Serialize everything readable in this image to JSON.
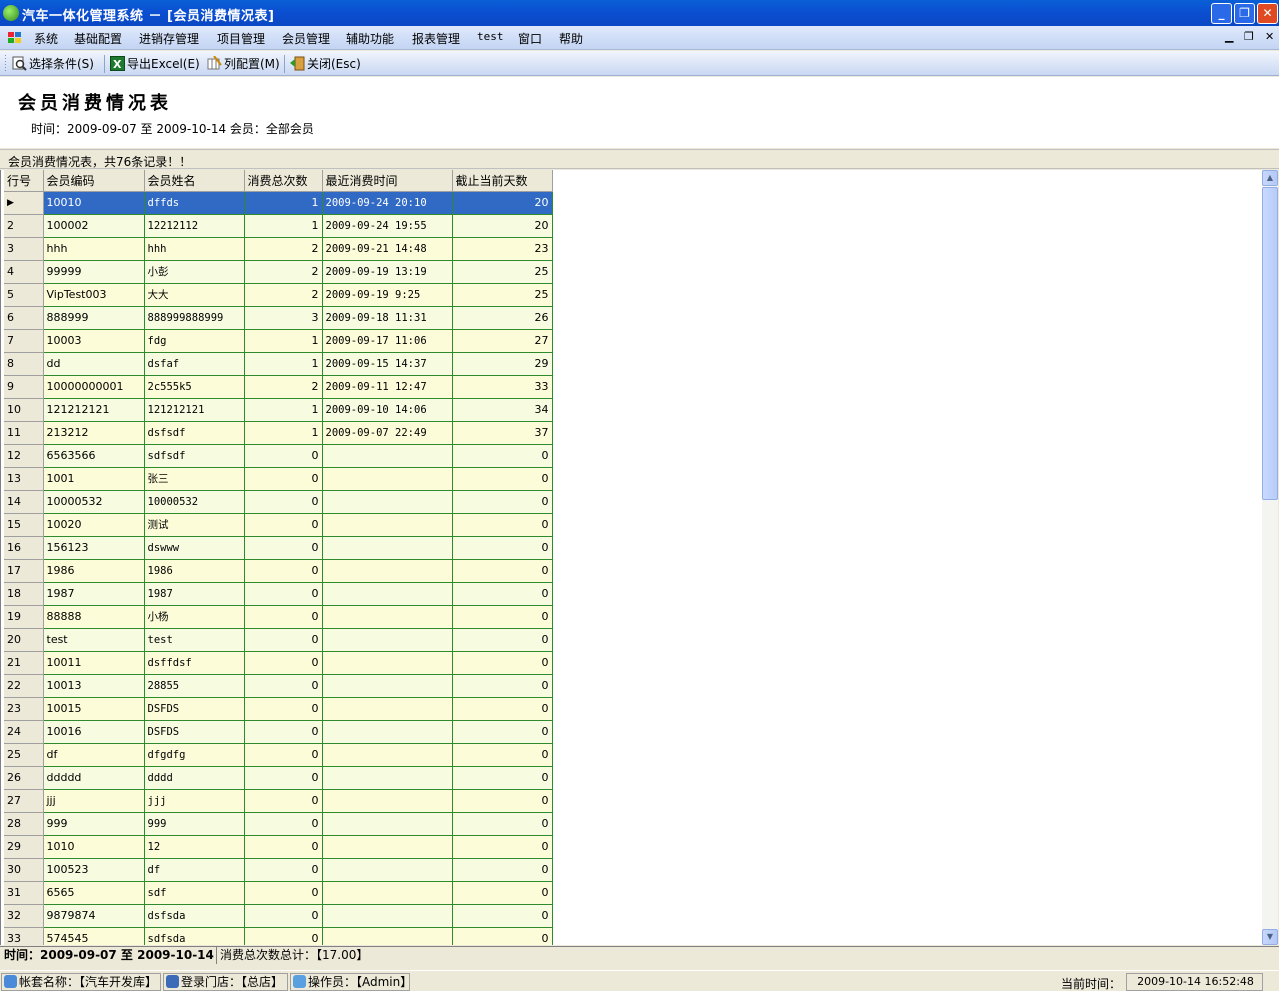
{
  "window": {
    "title": "汽车一体化管理系统 － [会员消费情况表]"
  },
  "menu": {
    "items": [
      "系统",
      "基础配置",
      "进销存管理",
      "项目管理",
      "会员管理",
      "辅助功能",
      "报表管理",
      "test",
      "窗口",
      "帮助"
    ]
  },
  "toolbar": {
    "select": "选择条件(S)",
    "export": "导出Excel(E)",
    "columns": "列配置(M)",
    "close": "关闭(Esc)"
  },
  "report": {
    "title": "会员消费情况表",
    "filter": "时间：2009-09-07 至 2009-10-14     会员：全部会员"
  },
  "caption": "会员消费情况表，共76条记录！！",
  "columns": [
    "行号",
    "会员编码",
    "会员姓名",
    "消费总次数",
    "最近消费时间",
    "截止当前天数"
  ],
  "rows": [
    [
      "1",
      "10010",
      "dffds",
      "1",
      "2009-09-24 20:10",
      "20"
    ],
    [
      "2",
      "100002",
      "12212112",
      "1",
      "2009-09-24 19:55",
      "20"
    ],
    [
      "3",
      "hhh",
      "hhh",
      "2",
      "2009-09-21 14:48",
      "23"
    ],
    [
      "4",
      "99999",
      "小彭",
      "2",
      "2009-09-19 13:19",
      "25"
    ],
    [
      "5",
      "VipTest003",
      "大大",
      "2",
      "2009-09-19 9:25",
      "25"
    ],
    [
      "6",
      "888999",
      "888999888999",
      "3",
      "2009-09-18 11:31",
      "26"
    ],
    [
      "7",
      "10003",
      "fdg",
      "1",
      "2009-09-17 11:06",
      "27"
    ],
    [
      "8",
      "dd",
      "dsfaf",
      "1",
      "2009-09-15 14:37",
      "29"
    ],
    [
      "9",
      "10000000001",
      "2c555k5",
      "2",
      "2009-09-11 12:47",
      "33"
    ],
    [
      "10",
      "121212121",
      "121212121",
      "1",
      "2009-09-10 14:06",
      "34"
    ],
    [
      "11",
      "213212",
      "dsfsdf",
      "1",
      "2009-09-07 22:49",
      "37"
    ],
    [
      "12",
      "6563566",
      "sdfsdf",
      "0",
      "",
      "0"
    ],
    [
      "13",
      "1001",
      "张三",
      "0",
      "",
      "0"
    ],
    [
      "14",
      "10000532",
      "10000532",
      "0",
      "",
      "0"
    ],
    [
      "15",
      "10020",
      "测试",
      "0",
      "",
      "0"
    ],
    [
      "16",
      "156123",
      "dswww",
      "0",
      "",
      "0"
    ],
    [
      "17",
      "1986",
      "1986",
      "0",
      "",
      "0"
    ],
    [
      "18",
      "1987",
      "1987",
      "0",
      "",
      "0"
    ],
    [
      "19",
      "88888",
      "小杨",
      "0",
      "",
      "0"
    ],
    [
      "20",
      "test",
      "test",
      "0",
      "",
      "0"
    ],
    [
      "21",
      "10011",
      "dsffdsf",
      "0",
      "",
      "0"
    ],
    [
      "22",
      "10013",
      "28855",
      "0",
      "",
      "0"
    ],
    [
      "23",
      "10015",
      "DSFDS",
      "0",
      "",
      "0"
    ],
    [
      "24",
      "10016",
      "DSFDS",
      "0",
      "",
      "0"
    ],
    [
      "25",
      "df",
      "dfgdfg",
      "0",
      "",
      "0"
    ],
    [
      "26",
      "ddddd",
      "dddd",
      "0",
      "",
      "0"
    ],
    [
      "27",
      "jjj",
      "jjj",
      "0",
      "",
      "0"
    ],
    [
      "28",
      "999",
      "999",
      "0",
      "",
      "0"
    ],
    [
      "29",
      "1010",
      "12",
      "0",
      "",
      "0"
    ],
    [
      "30",
      "100523",
      "df",
      "0",
      "",
      "0"
    ],
    [
      "31",
      "6565",
      "sdf",
      "0",
      "",
      "0"
    ],
    [
      "32",
      "9879874",
      "dsfsda",
      "0",
      "",
      "0"
    ],
    [
      "33",
      "574545",
      "sdfsda",
      "0",
      "",
      "0"
    ]
  ],
  "summary": {
    "range": "时间：2009-09-07 至 2009-10-14",
    "total": "消费总次数总计：【17.00】"
  },
  "status": {
    "account": "帐套名称：【汽车开发库】",
    "store": "登录门店：【总店】",
    "operator": "操作员：【Admin】",
    "time_label": "当前时间：",
    "time": "2009-10-14 16:52:48"
  },
  "icons": [
    "app-logo-icon",
    "magnifier-icon",
    "excel-icon",
    "column-config-icon",
    "exit-door-icon",
    "scroll-up-icon",
    "scroll-down-icon"
  ],
  "colors": {
    "titlebar": "#0b4ed1",
    "selected_row": "#316ac5",
    "row_yellow": "#fcfcd8",
    "grid_line": "#2d8a2d"
  }
}
